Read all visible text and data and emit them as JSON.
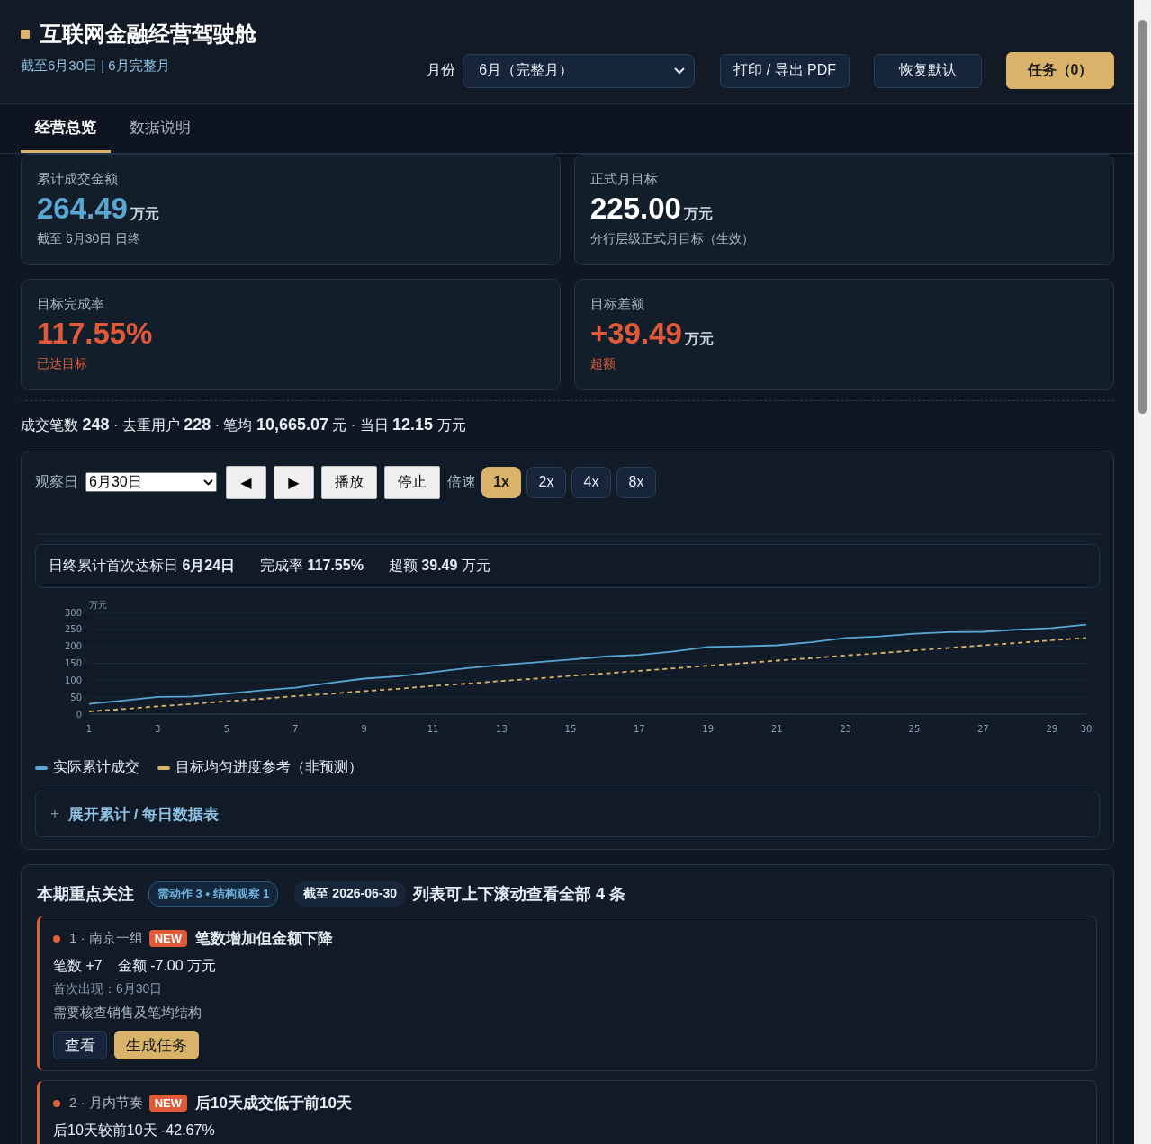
{
  "header": {
    "title": "互联网金融经营驾驶舱",
    "subtitle": "截至6月30日 | 6月完整月",
    "month_label": "月份",
    "month_value": "6月（完整月）",
    "buttons": [
      {
        "label": "打印 / 导出 PDF",
        "kind": "plain"
      },
      {
        "label": "恢复默认",
        "kind": "plain"
      },
      {
        "label": "任务（0）",
        "kind": "primary"
      }
    ]
  },
  "tabs": [
    {
      "label": "经营总览",
      "selected": true
    },
    {
      "label": "数据说明",
      "selected": false
    }
  ],
  "kpi_cards": [
    {
      "label": "累计成交金额",
      "value": "264.49",
      "unit": "万元",
      "note": "截至 6月30日 日终",
      "color": "#5aa7d4",
      "kind": "normal"
    },
    {
      "label": "正式月目标",
      "value": "225.00",
      "unit": "万元",
      "note": "分行层级正式月目标（生效）",
      "color": "#ffffff",
      "kind": "normal"
    },
    {
      "label": "目标完成率",
      "value": "117.55%",
      "note": "已达目标",
      "color": "#e05a3a",
      "kind": "alert"
    },
    {
      "label": "目标差额",
      "value": "+39.49",
      "unit": "万元",
      "note": "超额",
      "color": "#e05a3a",
      "kind": "alert"
    }
  ],
  "summary": "成交笔数 **248** · 去重用户 **228** · 笔均 **10,665.07** 元 · 当日 **12.15** 万元",
  "playback": {
    "day_label": "观察日",
    "day_value": "6月30日",
    "prev": "◀",
    "next": "▶",
    "play": "播放",
    "stop": "停止",
    "speed_label": "倍速",
    "speeds": [
      {
        "label": "1x",
        "selected": true
      },
      {
        "label": "2x",
        "selected": false
      },
      {
        "label": "4x",
        "selected": false
      },
      {
        "label": "8x",
        "selected": false
      }
    ]
  },
  "milestones": [
    "日终累计首次达标日 **6月24日**",
    "完成率 **117.55%**",
    "超额 **39.49** 万元"
  ],
  "chart_data": {
    "type": "line",
    "ylabel": "万元",
    "x": [
      1,
      2,
      3,
      4,
      5,
      6,
      7,
      8,
      9,
      10,
      11,
      12,
      13,
      14,
      15,
      16,
      17,
      18,
      19,
      20,
      21,
      22,
      23,
      24,
      25,
      26,
      27,
      28,
      29,
      30
    ],
    "xticks": [
      1,
      3,
      5,
      7,
      9,
      11,
      13,
      15,
      17,
      19,
      21,
      23,
      25,
      27,
      29,
      30
    ],
    "yticks": [
      0,
      50,
      100,
      150,
      200,
      250,
      300
    ],
    "ylim": [
      0,
      300
    ],
    "xlim": [
      1,
      30
    ],
    "grid": true,
    "series": [
      {
        "name": "实际累计成交",
        "color": "#5aa7d4",
        "line_style": "solid",
        "values": [
          30,
          40,
          51,
          52,
          60,
          70,
          78,
          92,
          105,
          112,
          124,
          136,
          145,
          153,
          161,
          170,
          175,
          185,
          198,
          200,
          203,
          212,
          225,
          229,
          237,
          242,
          243,
          249,
          254,
          264
        ]
      },
      {
        "name": "目标均匀进度参考（非预测）",
        "color": "#d9b36a",
        "line_style": "dashed",
        "values": [
          8,
          15,
          23,
          30,
          38,
          45,
          53,
          60,
          68,
          75,
          83,
          90,
          98,
          105,
          113,
          120,
          128,
          135,
          143,
          150,
          158,
          165,
          173,
          180,
          188,
          195,
          203,
          210,
          218,
          225
        ]
      }
    ]
  },
  "table_toggle": {
    "icon": "+",
    "label": "展开累计 / 每日数据表",
    "expanded": false
  },
  "focus": {
    "title": "本期重点关注",
    "badge": "需动作 3 • 结构观察 1",
    "date_chip": "截至 2026-06-30",
    "hint": "列表可上下滚动查看全部 4 条",
    "items": [
      {
        "index_label": "1 · 南京一组",
        "tag": "NEW",
        "title": "笔数增加但金额下降",
        "color": "#e0603a",
        "metrics": [
          "笔数 +7",
          "金额 -7.00 万元"
        ],
        "first_seen": "首次出现：6月30日",
        "note": "需要核查销售及笔均结构",
        "actions": [
          {
            "label": "查看",
            "kind": "plain"
          },
          {
            "label": "生成任务",
            "kind": "primary"
          }
        ]
      },
      {
        "index_label": "2 · 月内节奏",
        "tag": "NEW",
        "title": "后10天成交低于前10天",
        "color": "#e0603a",
        "metrics": [
          "后10天较前10天 -42.67%"
        ]
      }
    ]
  }
}
